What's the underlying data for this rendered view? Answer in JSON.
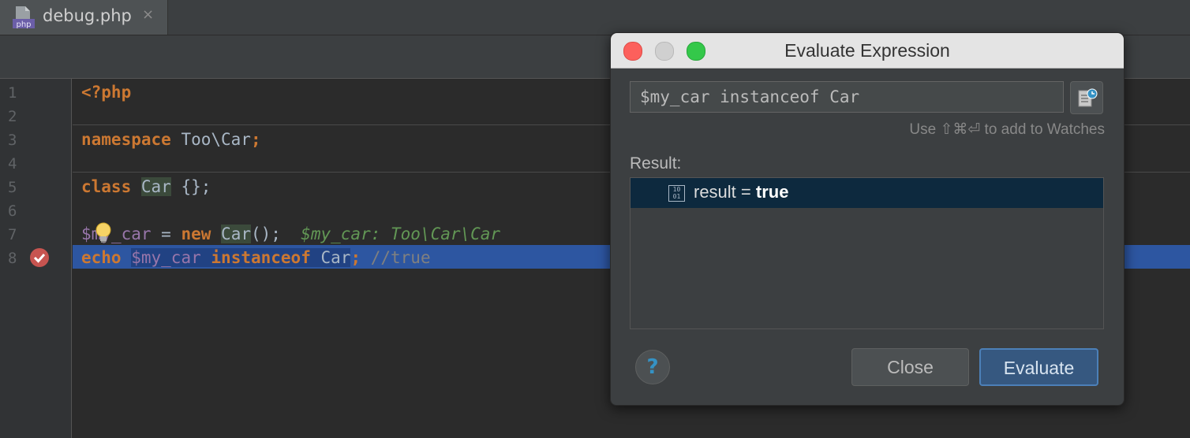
{
  "tab": {
    "filename": "debug.php",
    "close": "×",
    "icon": "php-file-icon",
    "icon_label": "php"
  },
  "gutter": {
    "lines": [
      "1",
      "2",
      "3",
      "4",
      "5",
      "6",
      "7",
      "8"
    ],
    "breakpoint": "breakpoint-icon"
  },
  "code": {
    "l1_kw": "<?php",
    "l3_kw": "namespace",
    "l3_rest": " Too\\Car",
    "l3_semi": ";",
    "l5_kw": "class",
    "l5_sp": " ",
    "l5_cls": "Car",
    "l5_rest": " {};",
    "l7_var_a": "$m",
    "l7_var_b": "y_car",
    "l7_eq": " = ",
    "l7_new": "new",
    "l7_sp": " ",
    "l7_cls": "Car",
    "l7_paren": "();",
    "l7_hint": "  $my_car: Too\\Car\\Car",
    "l8_echo": "echo",
    "l8_sp": " ",
    "l8_var": "$my_car",
    "l8_sp2": " ",
    "l8_kw": "instanceof",
    "l8_sp3": " ",
    "l8_cls": "Car",
    "l8_semi": ";",
    "l8_comment": " //true"
  },
  "dialog": {
    "title": "Evaluate Expression",
    "expression": "$my_car instanceof Car",
    "hint": "Use ⇧⌘⏎ to add to Watches",
    "result_label": "Result:",
    "result_name": "result = ",
    "result_value": "true",
    "result_icon_text": "10 01",
    "help": "?",
    "close_label": "Close",
    "evaluate_label": "Evaluate",
    "colors": {
      "selection": "#0d293e",
      "default_button": "#365880"
    }
  }
}
